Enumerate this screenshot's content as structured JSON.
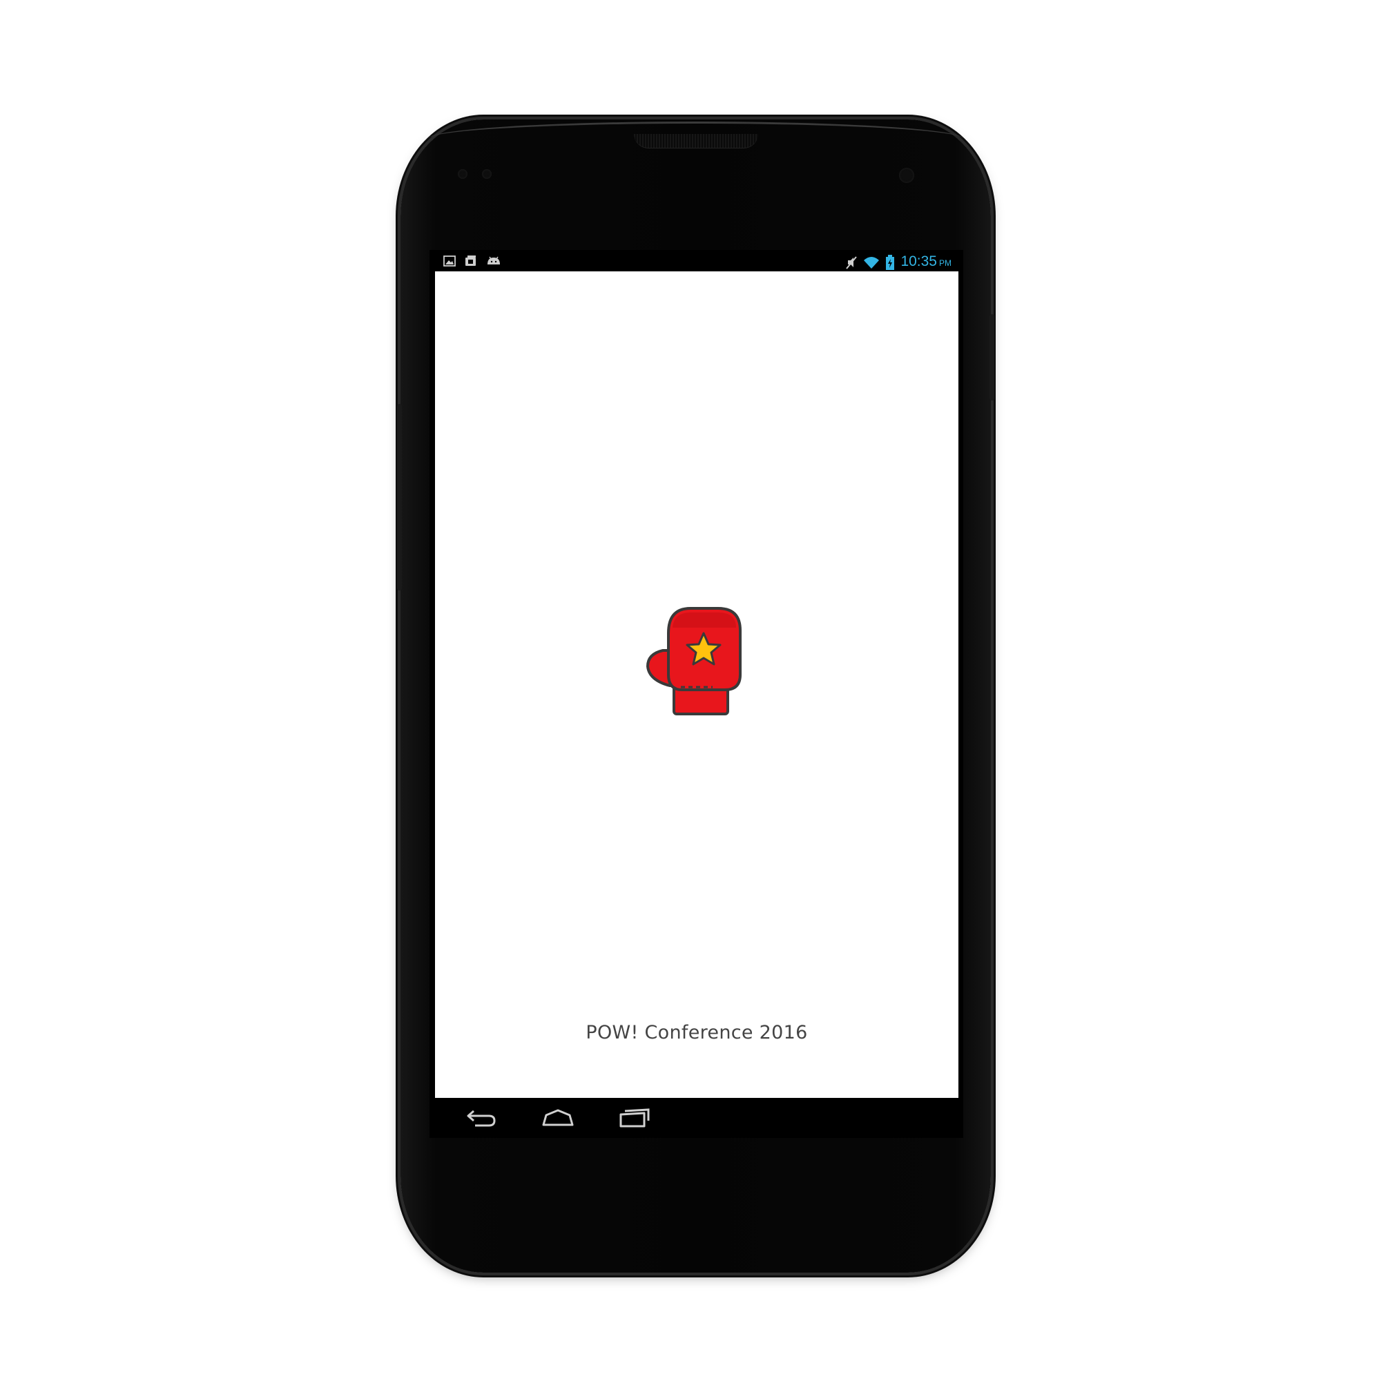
{
  "status_bar": {
    "time": "10:35",
    "ampm": "PM",
    "clock_color": "#33b5e5",
    "left_icons": [
      "gallery-icon",
      "media-icon",
      "android-icon"
    ],
    "right_icons": [
      "mute-icon",
      "wifi-icon",
      "battery-charging-icon"
    ]
  },
  "app": {
    "footer_text": "POW! Conference 2016",
    "logo": "boxing-glove-star-icon",
    "glove_color": "#e8161c",
    "star_color": "#ffc20e"
  },
  "nav_bar": {
    "buttons": [
      "back-button",
      "home-button",
      "recent-apps-button"
    ]
  }
}
